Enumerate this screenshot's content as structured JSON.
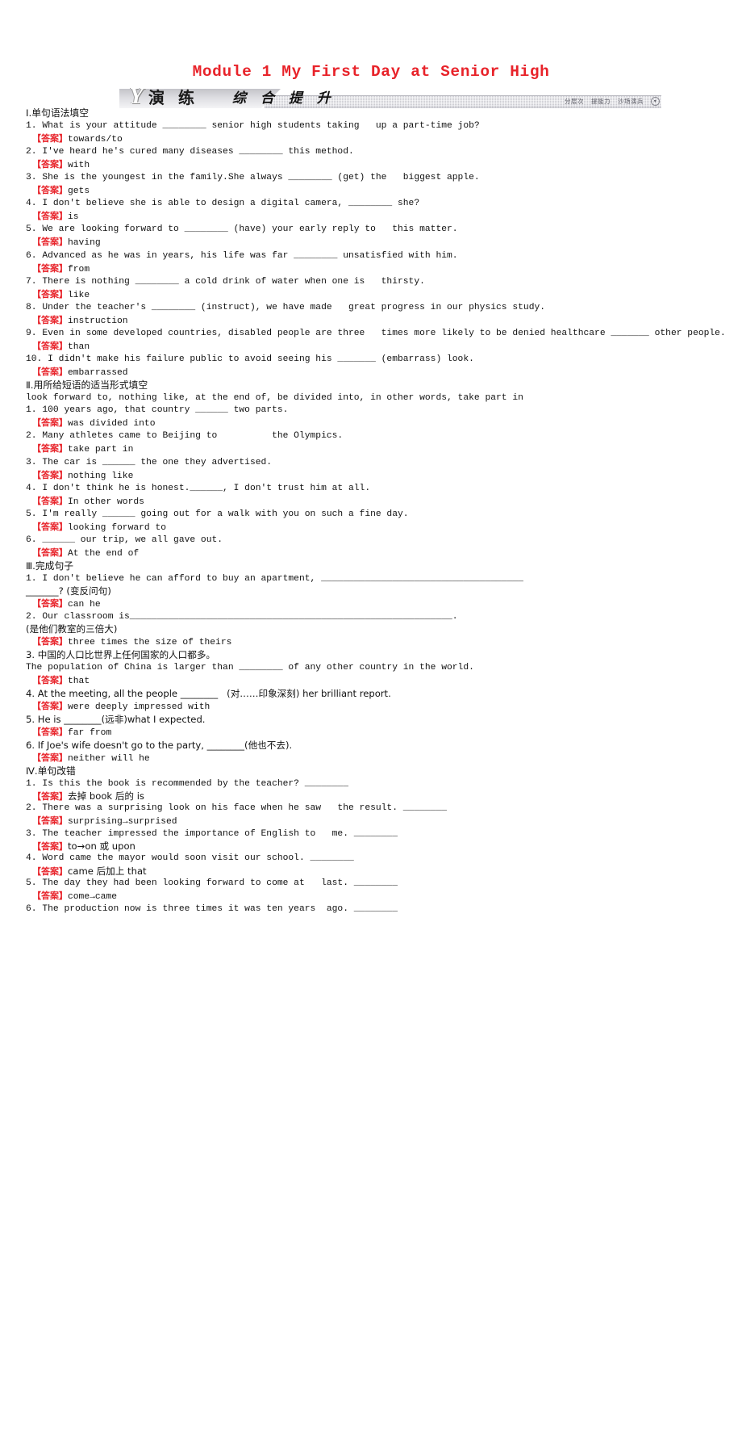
{
  "title": "Module 1 My First Day at Senior High",
  "banner": {
    "logo_letter": "Y",
    "label_main": "演 练",
    "label_sub": "综 合 提 升",
    "tags": [
      "分层次",
      "提能力",
      "沙场演兵"
    ],
    "tag_icon": "chevron-down-icon",
    "accent_color": "#e8232a"
  },
  "answer_label": "【答案】",
  "sections": [
    {
      "heading": "Ⅰ.单句语法填空",
      "items": [
        {
          "q": "1. What is your attitude ________ senior high students taking   up a part-time job?",
          "a": "towards/to"
        },
        {
          "q": "2. I've heard he's cured many diseases ________ this method.",
          "a": "with"
        },
        {
          "q": "3. She is the youngest in the family.She always ________ (get) the   biggest apple.",
          "a": "gets"
        },
        {
          "q": "4. I don't believe she is able to design a digital camera, ________ she?",
          "a": "is"
        },
        {
          "q": "5. We are looking forward to ________ (have) your early reply to   this matter.",
          "a": "having"
        },
        {
          "q": "6. Advanced as he was in years, his life was far ________ unsatisfied with him.",
          "a": "from"
        },
        {
          "q": "7. There is nothing ________ a cold drink of water when one is   thirsty.",
          "a": "like"
        },
        {
          "q": "8. Under the teacher's ________ (instruct), we have made   great progress in our physics study.",
          "a": "instruction"
        },
        {
          "q": "9. Even in some developed countries, disabled people are three   times more likely to be denied healthcare _______ other people.",
          "a": "than"
        },
        {
          "q": "10. I didn't make his failure public to avoid seeing his _______ (embarrass) look.",
          "a": "embarrassed"
        }
      ]
    },
    {
      "heading": "Ⅱ.用所给短语的适当形式填空",
      "wordbank": "look forward to, nothing like, at the end of, be divided into, in other words, take part in",
      "items": [
        {
          "q": "1. 100 years ago, that country ______ two parts.",
          "a": "was divided into"
        },
        {
          "q": "2. Many athletes came to Beijing to          the Olympics.",
          "a": "take part in"
        },
        {
          "q": "3. The car is ______ the one they advertised.",
          "a": "nothing like"
        },
        {
          "q": "4. I don't think he is honest.______, I don't trust him at all.",
          "a": "In other words"
        },
        {
          "q": "5. I'm really ______ going out for a walk with you on such a fine day.",
          "a": "looking forward to"
        },
        {
          "q": "6. ______ our trip, we all gave out.",
          "a": "At the end of"
        }
      ]
    },
    {
      "heading": "Ⅲ.完成句子",
      "items": [
        {
          "q": "1. I don't believe he can afford to buy an apartment, _____________________________________",
          "q2": "_______? (变反问句)",
          "a": "can he"
        },
        {
          "q": "2. Our classroom is___________________________________________________________.",
          "q2": "(是他们教室的三倍大)",
          "a": "three times the size of theirs"
        },
        {
          "q": "3. 中国的人口比世界上任何国家的人口都多。",
          "q2": "The population of China is larger than ________ of any other country in the world.",
          "a": "that"
        },
        {
          "q": "4. At the meeting, all the people ________   (对……印象深刻) her brilliant report.",
          "a": "were deeply impressed with"
        },
        {
          "q": "5. He is ________(远非)what I expected.",
          "a": "far from"
        },
        {
          "q": "6. If Joe's wife doesn't go to the party, ________(他也不去).",
          "a": "neither will he"
        }
      ]
    },
    {
      "heading": "Ⅳ.单句改错",
      "items": [
        {
          "q": "1. Is this the book is recommended by the teacher? ________",
          "a": "去掉 book 后的 is"
        },
        {
          "q": "2. There was a surprising look on his face when he saw   the result. ________",
          "a": "surprising→surprised"
        },
        {
          "q": "3. The teacher impressed the importance of English to   me. ________",
          "a": "to→on 或 upon"
        },
        {
          "q": "4. Word came the mayor would soon visit our school. ________",
          "a": "came 后加上 that"
        },
        {
          "q": "5. The day they had been looking forward to come at   last. ________",
          "a": "come→came"
        },
        {
          "q": "6. The production now is three times it was ten years  ago. ________",
          "a": ""
        }
      ]
    }
  ]
}
